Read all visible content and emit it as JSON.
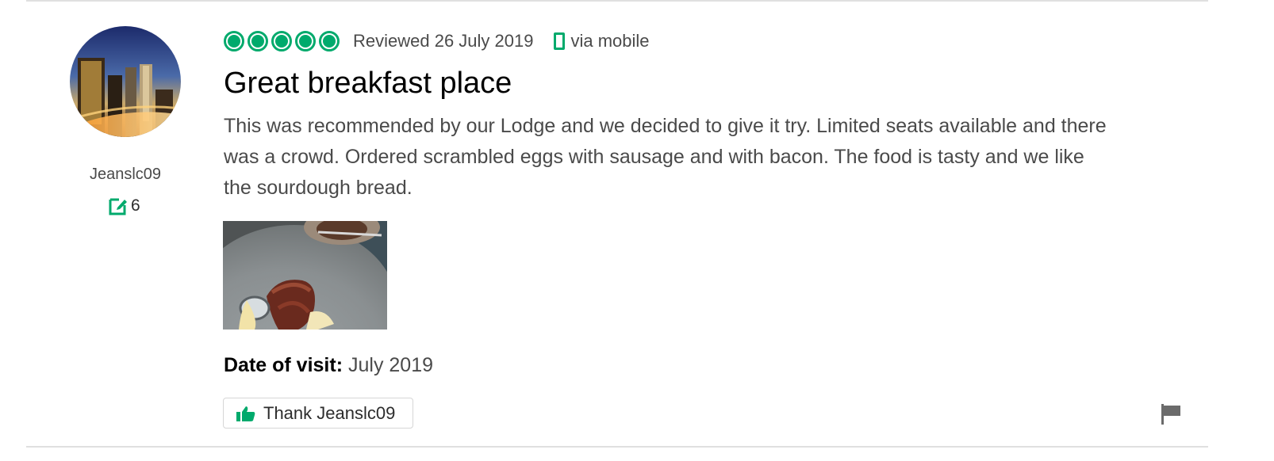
{
  "colors": {
    "brand_green": "#00aa6c",
    "text_dark": "#000000",
    "text_body": "#4a4a4a",
    "divider": "#e0e0e0"
  },
  "reviewer": {
    "username": "Jeanslc09",
    "contribution_icon": "pencil-square-icon",
    "contributions": "6"
  },
  "review": {
    "rating": 5,
    "rating_max": 5,
    "reviewed_text": "Reviewed 26 July 2019",
    "device_icon": "mobile-phone-icon",
    "via_text": "via mobile",
    "title": "Great breakfast place",
    "body": "This was recommended by our Lodge and we decided to give it try. Limited seats available and there was a crowd. Ordered scrambled eggs with sausage and with bacon. The food is tasty and we like the sourdough bread.",
    "date_of_visit_label": "Date of visit:",
    "date_of_visit_value": "July 2019"
  },
  "actions": {
    "thank_icon": "thumbs-up-icon",
    "thank_label": "Thank Jeanslc09",
    "report_icon": "flag-icon"
  }
}
